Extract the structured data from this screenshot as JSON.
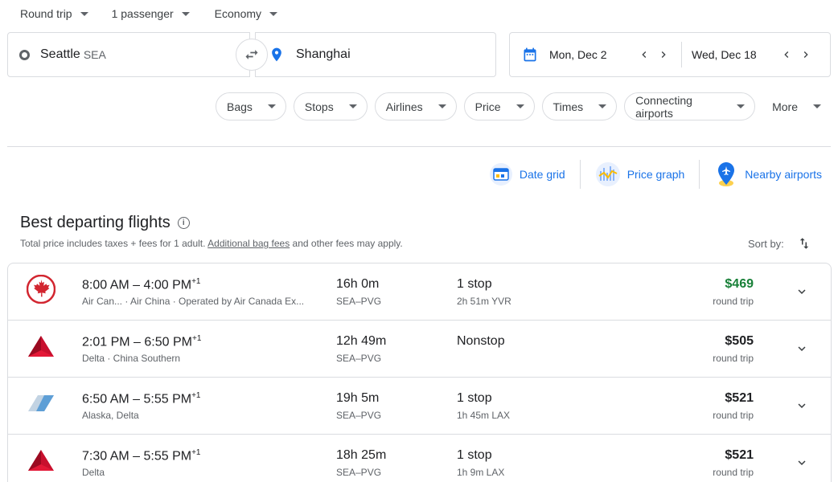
{
  "top_selectors": {
    "trip_type": "Round trip",
    "passengers": "1 passenger",
    "cabin": "Economy"
  },
  "search": {
    "origin_city": "Seattle",
    "origin_code": "SEA",
    "destination": "Shanghai",
    "depart_date": "Mon, Dec 2",
    "return_date": "Wed, Dec 18"
  },
  "filters": [
    "Bags",
    "Stops",
    "Airlines",
    "Price",
    "Times",
    "Connecting airports",
    "More"
  ],
  "tools": {
    "date_grid": "Date grid",
    "price_graph": "Price graph",
    "nearby_airports": "Nearby airports"
  },
  "results": {
    "heading": "Best departing flights",
    "info_icon": "info-icon",
    "subtitle_prefix": "Total price includes taxes + fees for 1 adult. ",
    "subtitle_link": "Additional bag fees",
    "subtitle_suffix": " and other fees may apply.",
    "sort_label": "Sort by:"
  },
  "flights": [
    {
      "airline_icon": "air-canada-logo",
      "depart": "8:00 AM",
      "arrive": "4:00 PM",
      "day_offset": "+1",
      "airlines": "Air Can...   ·  Air China   ·  Operated by Air Canada Ex...",
      "duration": "16h 0m",
      "route": "SEA–PVG",
      "stops": "1 stop",
      "layover": "2h 51m YVR",
      "price": "$469",
      "price_type": "round trip",
      "price_color": "#188038"
    },
    {
      "airline_icon": "delta-logo",
      "depart": "2:01 PM",
      "arrive": "6:50 PM",
      "day_offset": "+1",
      "airlines": "Delta  ·  China Southern",
      "duration": "12h 49m",
      "route": "SEA–PVG",
      "stops": "Nonstop",
      "layover": "",
      "price": "$505",
      "price_type": "round trip",
      "price_color": "#202124"
    },
    {
      "airline_icon": "alaska-logo",
      "depart": "6:50 AM",
      "arrive": "5:55 PM",
      "day_offset": "+1",
      "airlines": "Alaska, Delta",
      "duration": "19h 5m",
      "route": "SEA–PVG",
      "stops": "1 stop",
      "layover": "1h 45m LAX",
      "price": "$521",
      "price_type": "round trip",
      "price_color": "#202124"
    },
    {
      "airline_icon": "delta-logo",
      "depart": "7:30 AM",
      "arrive": "5:55 PM",
      "day_offset": "+1",
      "airlines": "Delta",
      "duration": "18h 25m",
      "route": "SEA–PVG",
      "stops": "1 stop",
      "layover": "1h 9m LAX",
      "price": "$521",
      "price_type": "round trip",
      "price_color": "#202124"
    }
  ]
}
